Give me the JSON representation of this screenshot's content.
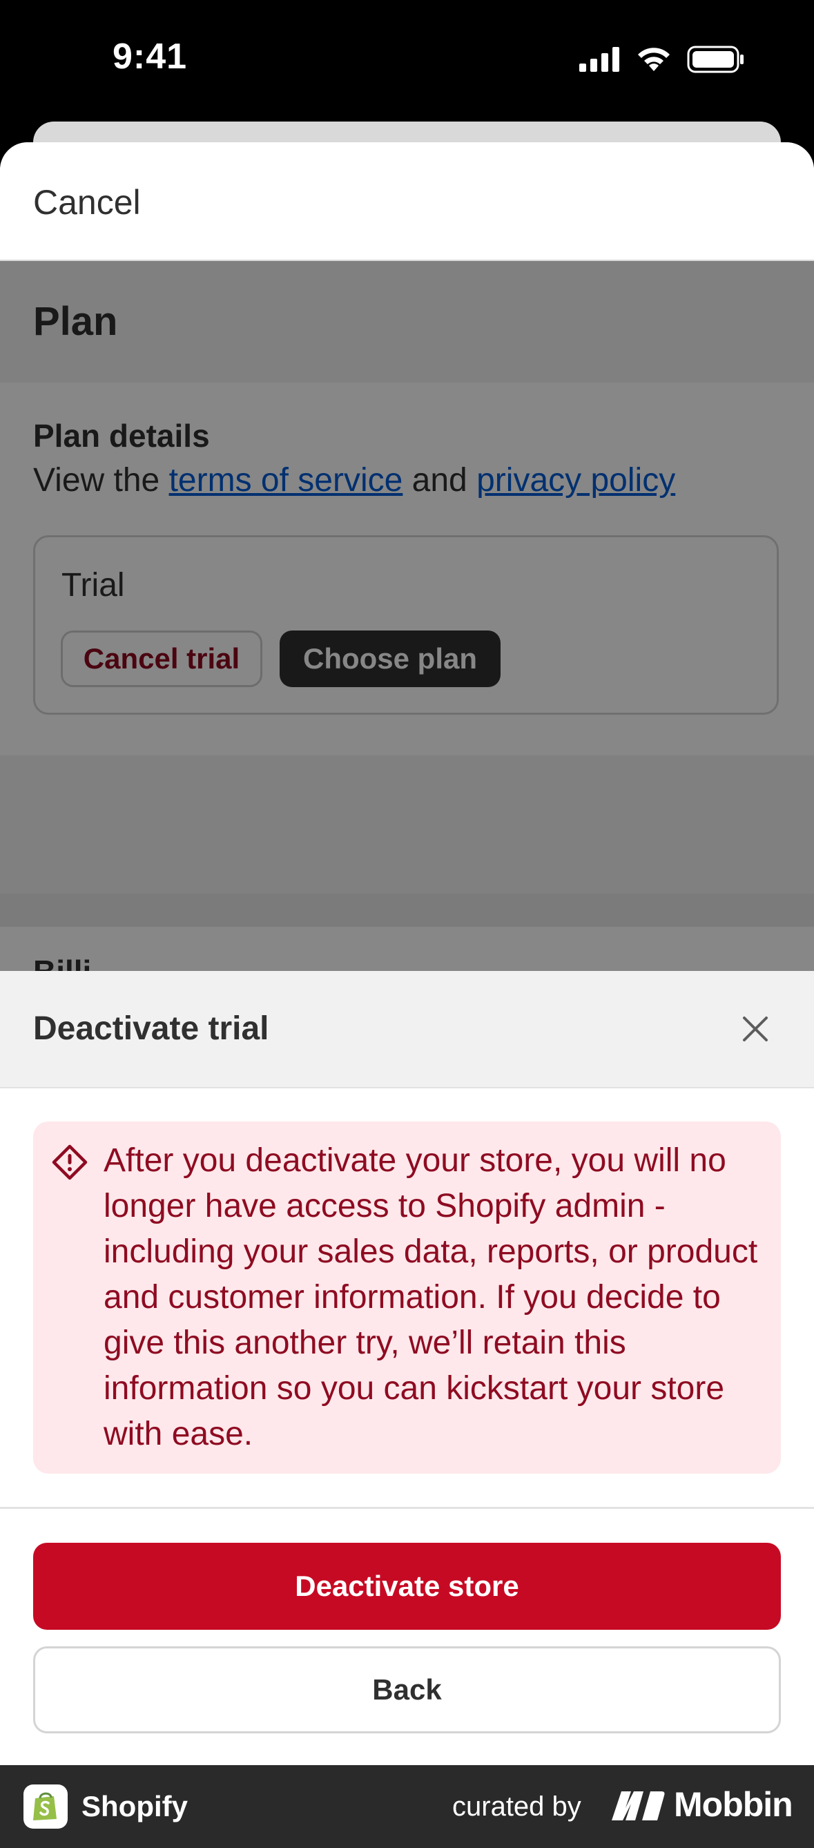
{
  "status": {
    "time": "9:41"
  },
  "nav": {
    "cancel": "Cancel"
  },
  "plan": {
    "title": "Plan",
    "details_title": "Plan details",
    "details_prefix": "View the ",
    "terms_link": "terms of service",
    "details_and": " and ",
    "privacy_link": "privacy policy",
    "trial_label": "Trial",
    "cancel_trial": "Cancel trial",
    "choose_plan": "Choose plan",
    "next_section_peek": "Billi"
  },
  "modal": {
    "title": "Deactivate trial",
    "warning": "After you deactivate your store, you will no longer have access to Shopify admin - including your sales data, reports, or product and customer information. If you decide to give this another try, we’ll retain this information so you can kickstart your store with ease.",
    "deactivate_button": "Deactivate store",
    "back_button": "Back"
  },
  "footer": {
    "app_name": "Shopify",
    "curated_by": "curated by",
    "brand": "Mobbin"
  },
  "colors": {
    "critical": "#c70a24",
    "critical_text": "#8e0b21",
    "banner_bg": "#fee8eb",
    "link": "#005bd3",
    "shopify_green": "#95bf47"
  },
  "icons": [
    "signal-icon",
    "wifi-icon",
    "battery-icon",
    "close-icon",
    "alert-diamond-icon",
    "shopify-logo-icon",
    "mobbin-logo-icon"
  ]
}
